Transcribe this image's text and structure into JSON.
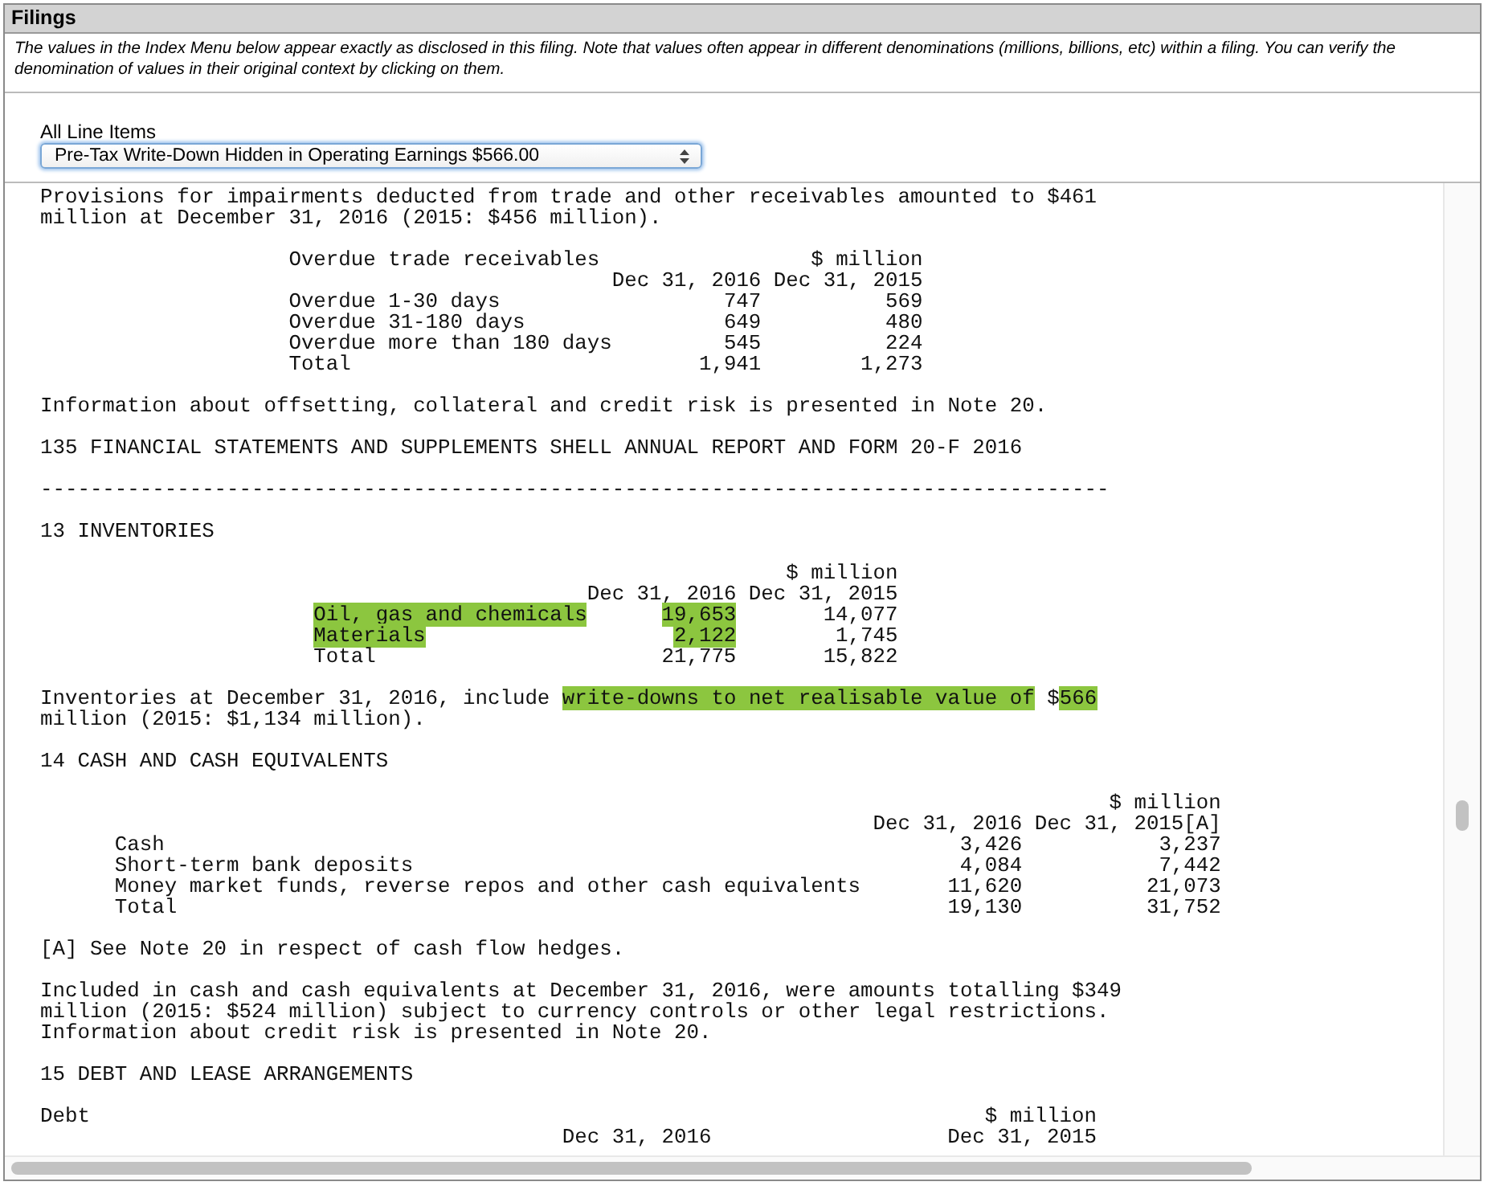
{
  "panel": {
    "title": "Filings",
    "description": "The values in the Index Menu below appear exactly as disclosed in this filing. Note that values often appear in different denominations (millions, billions, etc) within a filing. You can verify the denomination of values in their original context by clicking on them.",
    "select_label": "All Line Items",
    "select_value": "Pre-Tax Write-Down Hidden in Operating Earnings $566.00"
  },
  "document": [
    {
      "kind": "paragraph",
      "segments": [
        {
          "text": "Provisions for impairments deducted from trade and other receivables amounted to $461 million at December 31, 2016 (2015: $456 million).",
          "highlighted": false
        }
      ]
    },
    {
      "kind": "table",
      "caption": "Overdue trade receivables",
      "unit": "$ million",
      "periods": [
        "Dec 31, 2016",
        "Dec 31, 2015"
      ],
      "rows": [
        {
          "label": {
            "text": "Overdue 1-30 days",
            "highlighted": false
          },
          "values": [
            {
              "text": "747",
              "highlighted": false
            },
            {
              "text": "569",
              "highlighted": false
            }
          ]
        },
        {
          "label": {
            "text": "Overdue 31-180 days",
            "highlighted": false
          },
          "values": [
            {
              "text": "649",
              "highlighted": false
            },
            {
              "text": "480",
              "highlighted": false
            }
          ]
        },
        {
          "label": {
            "text": "Overdue more than 180 days",
            "highlighted": false
          },
          "values": [
            {
              "text": "545",
              "highlighted": false
            },
            {
              "text": "224",
              "highlighted": false
            }
          ]
        },
        {
          "label": {
            "text": "Total",
            "highlighted": false
          },
          "values": [
            {
              "text": "1,941",
              "highlighted": false
            },
            {
              "text": "1,273",
              "highlighted": false
            }
          ]
        }
      ]
    },
    {
      "kind": "paragraph",
      "segments": [
        {
          "text": "Information about offsetting, collateral and credit risk is presented in Note 20.",
          "highlighted": false
        }
      ]
    },
    {
      "kind": "heading",
      "text": "135 FINANCIAL STATEMENTS AND SUPPLEMENTS SHELL ANNUAL REPORT AND FORM 20-F 2016"
    },
    {
      "kind": "rule",
      "text": "--------------------------------------------------------------------------------------"
    },
    {
      "kind": "heading",
      "text": "13 INVENTORIES"
    },
    {
      "kind": "table",
      "unit": "$ million",
      "periods": [
        "Dec 31, 2016",
        "Dec 31, 2015"
      ],
      "rows": [
        {
          "label": {
            "text": "Oil, gas and chemicals",
            "highlighted": true
          },
          "values": [
            {
              "text": "19,653",
              "highlighted": true
            },
            {
              "text": "14,077",
              "highlighted": false
            }
          ]
        },
        {
          "label": {
            "text": "Materials",
            "highlighted": true
          },
          "values": [
            {
              "text": "2,122",
              "highlighted": true
            },
            {
              "text": "1,745",
              "highlighted": false
            }
          ]
        },
        {
          "label": {
            "text": "Total",
            "highlighted": false
          },
          "values": [
            {
              "text": "21,775",
              "highlighted": false
            },
            {
              "text": "15,822",
              "highlighted": false
            }
          ]
        }
      ]
    },
    {
      "kind": "paragraph",
      "segments": [
        {
          "text": "Inventories at December 31, 2016, include ",
          "highlighted": false
        },
        {
          "text": "write-downs to net realisable value of",
          "highlighted": true
        },
        {
          "text": " $",
          "highlighted": false
        },
        {
          "text": "566",
          "highlighted": true
        },
        {
          "text": " million (2015: $1,134 million).",
          "highlighted": false
        }
      ]
    },
    {
      "kind": "heading",
      "text": "14 CASH AND CASH EQUIVALENTS"
    },
    {
      "kind": "table",
      "unit": "$ million",
      "periods": [
        "Dec 31, 2016",
        "Dec 31, 2015[A]"
      ],
      "rows": [
        {
          "label": {
            "text": "Cash",
            "highlighted": false
          },
          "values": [
            {
              "text": "3,426",
              "highlighted": false
            },
            {
              "text": "3,237",
              "highlighted": false
            }
          ]
        },
        {
          "label": {
            "text": "Short-term bank deposits",
            "highlighted": false
          },
          "values": [
            {
              "text": "4,084",
              "highlighted": false
            },
            {
              "text": "7,442",
              "highlighted": false
            }
          ]
        },
        {
          "label": {
            "text": "Money market funds, reverse repos and other cash equivalents",
            "highlighted": false
          },
          "values": [
            {
              "text": "11,620",
              "highlighted": false
            },
            {
              "text": "21,073",
              "highlighted": false
            }
          ]
        },
        {
          "label": {
            "text": "Total",
            "highlighted": false
          },
          "values": [
            {
              "text": "19,130",
              "highlighted": false
            },
            {
              "text": "31,752",
              "highlighted": false
            }
          ]
        }
      ]
    },
    {
      "kind": "paragraph",
      "segments": [
        {
          "text": "[A] See Note 20 in respect of cash flow hedges.",
          "highlighted": false
        }
      ]
    },
    {
      "kind": "paragraph",
      "segments": [
        {
          "text": "Included in cash and cash equivalents at December 31, 2016, were amounts totalling $349 million (2015: $524 million) subject to currency controls or other legal restrictions. Information about credit risk is presented in Note 20.",
          "highlighted": false
        }
      ]
    },
    {
      "kind": "heading",
      "text": "15 DEBT AND LEASE ARRANGEMENTS"
    },
    {
      "kind": "table",
      "caption": "Debt",
      "unit": "$ million",
      "periods": [
        "Dec 31, 2016",
        "Dec 31, 2015"
      ]
    }
  ]
}
